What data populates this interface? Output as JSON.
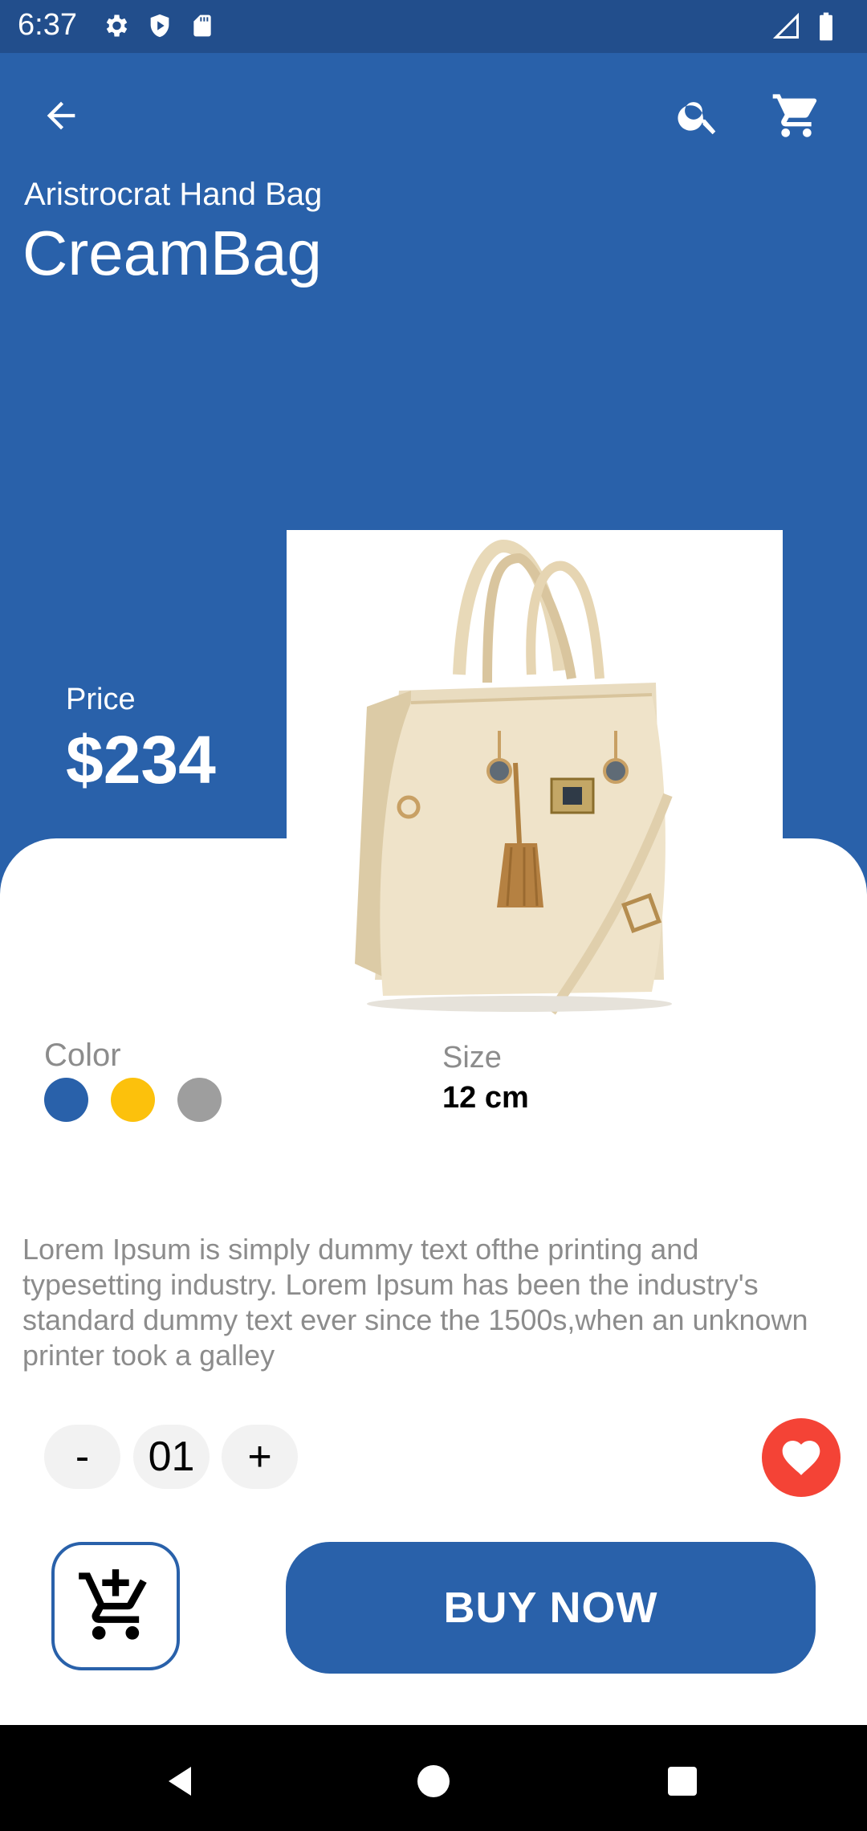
{
  "status_bar": {
    "time": "6:37"
  },
  "header": {
    "subtitle": "Aristrocrat Hand Bag",
    "title": "CreamBag"
  },
  "price": {
    "label": "Price",
    "value": "$234"
  },
  "colors": {
    "label": "Color",
    "options": [
      "#2961aa",
      "#fcc10c",
      "#9e9e9e"
    ]
  },
  "size": {
    "label": "Size",
    "value": "12 cm"
  },
  "description": "Lorem Ipsum is simply dummy text ofthe printing and typesetting industry. Lorem Ipsum has been the industry's standard dummy text ever since the 1500s,when an unknown printer took a galley",
  "quantity": {
    "decrement": "-",
    "value": "01",
    "increment": "+"
  },
  "actions": {
    "buy_now": "BUY NOW"
  },
  "theme": {
    "primary": "#2961aa",
    "favorite": "#f44336"
  }
}
